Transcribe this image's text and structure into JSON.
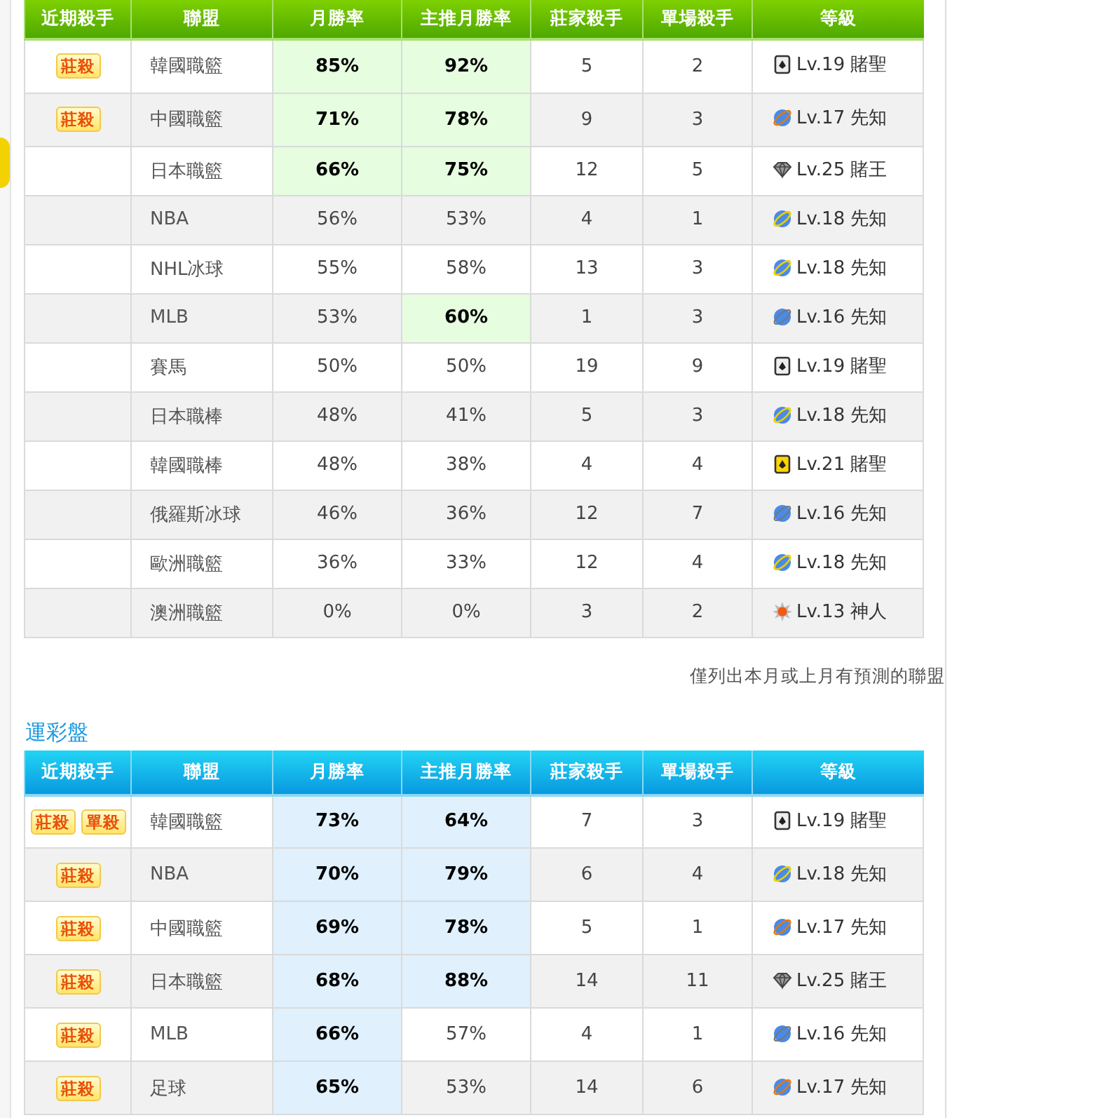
{
  "sections": [
    {
      "columns": [
        "近期殺手",
        "聯盟",
        "月勝率",
        "主推月勝率",
        "莊家殺手",
        "單場殺手",
        "等級"
      ],
      "rows": [
        {
          "badges": [
            "莊殺"
          ],
          "league": "韓國職籃",
          "monthly": {
            "value": "85%",
            "highlight": true
          },
          "main": {
            "value": "92%",
            "highlight": true
          },
          "banker": "5",
          "single": "2",
          "rank": {
            "kind": "card",
            "text": "Lv.19 賭聖"
          }
        },
        {
          "badges": [
            "莊殺"
          ],
          "league": "中國職籃",
          "monthly": {
            "value": "71%",
            "highlight": true
          },
          "main": {
            "value": "78%",
            "highlight": true
          },
          "banker": "9",
          "single": "3",
          "rank": {
            "kind": "planet-orange",
            "text": "Lv.17 先知"
          }
        },
        {
          "badges": [],
          "league": "日本職籃",
          "monthly": {
            "value": "66%",
            "highlight": true
          },
          "main": {
            "value": "75%",
            "highlight": true
          },
          "banker": "12",
          "single": "5",
          "rank": {
            "kind": "diamond",
            "text": "Lv.25 賭王"
          }
        },
        {
          "badges": [],
          "league": "NBA",
          "monthly": {
            "value": "56%",
            "highlight": false
          },
          "main": {
            "value": "53%",
            "highlight": false
          },
          "banker": "4",
          "single": "1",
          "rank": {
            "kind": "planet-yellow",
            "text": "Lv.18 先知"
          }
        },
        {
          "badges": [],
          "league": "NHL冰球",
          "monthly": {
            "value": "55%",
            "highlight": false
          },
          "main": {
            "value": "58%",
            "highlight": false
          },
          "banker": "13",
          "single": "3",
          "rank": {
            "kind": "planet-yellow",
            "text": "Lv.18 先知"
          }
        },
        {
          "badges": [],
          "league": "MLB",
          "monthly": {
            "value": "53%",
            "highlight": false
          },
          "main": {
            "value": "60%",
            "highlight": true
          },
          "banker": "1",
          "single": "3",
          "rank": {
            "kind": "planet-gray",
            "text": "Lv.16 先知"
          }
        },
        {
          "badges": [],
          "league": "賽馬",
          "monthly": {
            "value": "50%",
            "highlight": false
          },
          "main": {
            "value": "50%",
            "highlight": false
          },
          "banker": "19",
          "single": "9",
          "rank": {
            "kind": "card",
            "text": "Lv.19 賭聖"
          }
        },
        {
          "badges": [],
          "league": "日本職棒",
          "monthly": {
            "value": "48%",
            "highlight": false
          },
          "main": {
            "value": "41%",
            "highlight": false
          },
          "banker": "5",
          "single": "3",
          "rank": {
            "kind": "planet-yellow",
            "text": "Lv.18 先知"
          }
        },
        {
          "badges": [],
          "league": "韓國職棒",
          "monthly": {
            "value": "48%",
            "highlight": false
          },
          "main": {
            "value": "38%",
            "highlight": false
          },
          "banker": "4",
          "single": "4",
          "rank": {
            "kind": "card-gold",
            "text": "Lv.21 賭聖"
          }
        },
        {
          "badges": [],
          "league": "俄羅斯冰球",
          "monthly": {
            "value": "46%",
            "highlight": false
          },
          "main": {
            "value": "36%",
            "highlight": false
          },
          "banker": "12",
          "single": "7",
          "rank": {
            "kind": "planet-gray",
            "text": "Lv.16 先知"
          }
        },
        {
          "badges": [],
          "league": "歐洲職籃",
          "monthly": {
            "value": "36%",
            "highlight": false
          },
          "main": {
            "value": "33%",
            "highlight": false
          },
          "banker": "12",
          "single": "4",
          "rank": {
            "kind": "planet-yellow",
            "text": "Lv.18 先知"
          }
        },
        {
          "badges": [],
          "league": "澳洲職籃",
          "monthly": {
            "value": "0%",
            "highlight": false
          },
          "main": {
            "value": "0%",
            "highlight": false
          },
          "banker": "3",
          "single": "2",
          "rank": {
            "kind": "sun",
            "text": "Lv.13 神人"
          }
        }
      ],
      "note": "僅列出本月或上月有預測的聯盟"
    },
    {
      "title": "運彩盤",
      "columns": [
        "近期殺手",
        "聯盟",
        "月勝率",
        "主推月勝率",
        "莊家殺手",
        "單場殺手",
        "等級"
      ],
      "rows": [
        {
          "badges": [
            "莊殺",
            "單殺"
          ],
          "league": "韓國職籃",
          "monthly": {
            "value": "73%",
            "highlight": true
          },
          "main": {
            "value": "64%",
            "highlight": true
          },
          "banker": "7",
          "single": "3",
          "rank": {
            "kind": "card",
            "text": "Lv.19 賭聖"
          }
        },
        {
          "badges": [
            "莊殺"
          ],
          "league": "NBA",
          "monthly": {
            "value": "70%",
            "highlight": true
          },
          "main": {
            "value": "79%",
            "highlight": true
          },
          "banker": "6",
          "single": "4",
          "rank": {
            "kind": "planet-yellow",
            "text": "Lv.18 先知"
          }
        },
        {
          "badges": [
            "莊殺"
          ],
          "league": "中國職籃",
          "monthly": {
            "value": "69%",
            "highlight": true
          },
          "main": {
            "value": "78%",
            "highlight": true
          },
          "banker": "5",
          "single": "1",
          "rank": {
            "kind": "planet-orange",
            "text": "Lv.17 先知"
          }
        },
        {
          "badges": [
            "莊殺"
          ],
          "league": "日本職籃",
          "monthly": {
            "value": "68%",
            "highlight": true
          },
          "main": {
            "value": "88%",
            "highlight": true
          },
          "banker": "14",
          "single": "11",
          "rank": {
            "kind": "diamond",
            "text": "Lv.25 賭王"
          }
        },
        {
          "badges": [
            "莊殺"
          ],
          "league": "MLB",
          "monthly": {
            "value": "66%",
            "highlight": true
          },
          "main": {
            "value": "57%",
            "highlight": false
          },
          "banker": "4",
          "single": "1",
          "rank": {
            "kind": "planet-gray",
            "text": "Lv.16 先知"
          }
        },
        {
          "badges": [
            "莊殺"
          ],
          "league": "足球",
          "monthly": {
            "value": "65%",
            "highlight": true
          },
          "main": {
            "value": "53%",
            "highlight": false
          },
          "banker": "14",
          "single": "6",
          "rank": {
            "kind": "planet-orange",
            "text": "Lv.17 先知"
          }
        }
      ]
    }
  ]
}
